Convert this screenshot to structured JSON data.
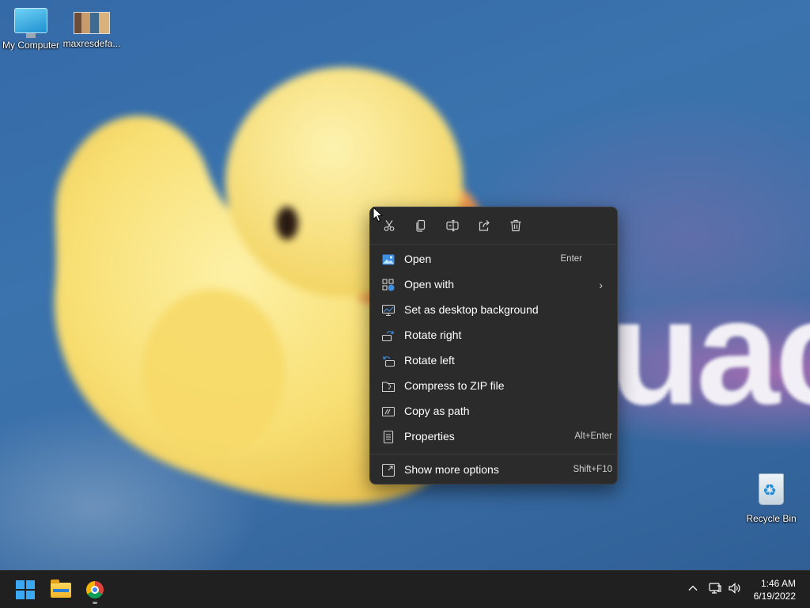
{
  "desktop": {
    "icons": [
      {
        "label": "My Computer"
      },
      {
        "label": "maxresdefa..."
      },
      {
        "label": "Recycle Bin"
      }
    ],
    "wallpaper_text": "uac"
  },
  "context_menu": {
    "toolbar": [
      "cut-icon",
      "copy-icon",
      "rename-icon",
      "share-icon",
      "delete-icon"
    ],
    "items": [
      {
        "label": "Open",
        "shortcut": "Enter",
        "icon": "image-icon"
      },
      {
        "label": "Open with",
        "shortcut": "",
        "icon": "open-with-icon",
        "submenu": "›"
      },
      {
        "label": "Set as desktop background",
        "shortcut": "",
        "icon": "desktop-background-icon"
      },
      {
        "label": "Rotate right",
        "shortcut": "",
        "icon": "rotate-right-icon"
      },
      {
        "label": "Rotate left",
        "shortcut": "",
        "icon": "rotate-left-icon"
      },
      {
        "label": "Compress to ZIP file",
        "shortcut": "",
        "icon": "zip-icon"
      },
      {
        "label": "Copy as path",
        "shortcut": "",
        "icon": "copy-path-icon"
      },
      {
        "label": "Properties",
        "shortcut": "Alt+Enter",
        "icon": "properties-icon"
      },
      {
        "label": "Show more options",
        "shortcut": "Shift+F10",
        "icon": "more-options-icon"
      }
    ]
  },
  "taskbar": {
    "apps": [
      "start-icon",
      "file-explorer-icon",
      "chrome-icon"
    ],
    "tray": [
      "chevron-up-icon",
      "network-icon",
      "volume-icon"
    ],
    "time": "1:46 AM",
    "date": "6/19/2022"
  },
  "colors": {
    "menu_bg": "#2b2b2b",
    "taskbar_bg": "#202020",
    "accent": "#3aa8f2"
  }
}
